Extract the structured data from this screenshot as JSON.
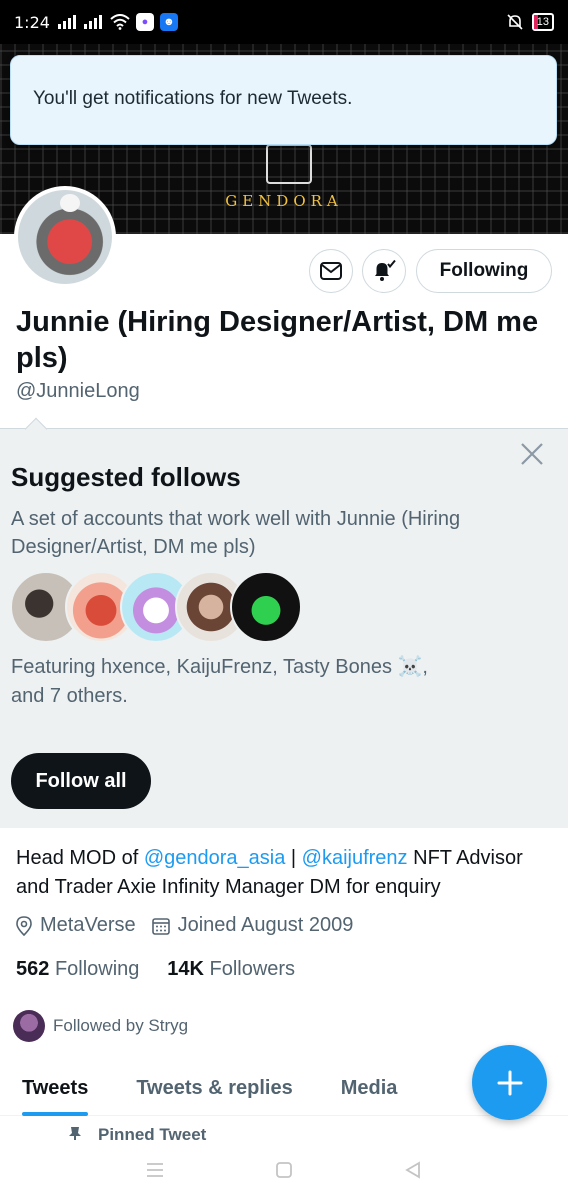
{
  "status_bar": {
    "time": "1:24",
    "battery": "13"
  },
  "banner": {
    "logo_text": "GENDORA"
  },
  "toast": {
    "message": "You'll get notifications for new Tweets."
  },
  "profile": {
    "name": "Junnie (Hiring Designer/Artist, DM me pls)",
    "handle": "@JunnieLong",
    "following_button": "Following"
  },
  "suggested": {
    "title": "Suggested follows",
    "description": "A set of accounts that work well with Junnie (Hiring Designer/Artist, DM me pls)",
    "featuring": "Featuring hxence, KaijuFrenz, Tasty Bones ☠️,",
    "featuring_more": "and 7 others.",
    "follow_all": "Follow all"
  },
  "bio": {
    "prefix": "Head MOD of ",
    "mention1": "@gendora_asia",
    "sep": " | ",
    "mention2": "@kaijufrenz",
    "suffix": "  NFT Advisor and Trader  Axie Infinity Manager  DM for enquiry"
  },
  "meta": {
    "location": "MetaVerse",
    "joined": "Joined August 2009"
  },
  "stats": {
    "following_count": "562",
    "following_label": "Following",
    "followers_count": "14K",
    "followers_label": "Followers"
  },
  "followed_by": "Followed by Stryg",
  "tabs": [
    "Tweets",
    "Tweets & replies",
    "Media"
  ],
  "pinned": "Pinned Tweet",
  "colors": {
    "accent": "#1d9bf0",
    "text_primary": "#0f1419",
    "text_secondary": "#536471",
    "toast_bg": "#e8f5fd"
  }
}
